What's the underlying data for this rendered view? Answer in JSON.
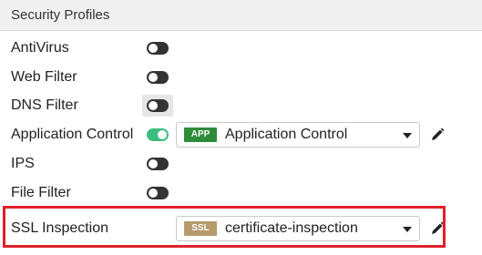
{
  "section": {
    "title": "Security Profiles"
  },
  "profiles": [
    {
      "label": "AntiVirus",
      "enabled": false
    },
    {
      "label": "Web Filter",
      "enabled": false
    },
    {
      "label": "DNS Filter",
      "enabled": false,
      "focused": true
    },
    {
      "label": "Application Control",
      "enabled": true,
      "select": {
        "badge": "APP",
        "badge_color": "#2e8b3a",
        "value": "Application Control"
      }
    },
    {
      "label": "IPS",
      "enabled": false
    },
    {
      "label": "File Filter",
      "enabled": false
    },
    {
      "label": "SSL Inspection",
      "select": {
        "badge": "SSL",
        "badge_color": "#b59a6b",
        "value": "certificate-inspection"
      }
    }
  ],
  "colors": {
    "toggle_on": "#3dbd7d",
    "toggle_off": "#333333",
    "highlight_border": "#e0202a"
  },
  "icons": {
    "edit": "pencil-icon",
    "dropdown": "caret-down-icon"
  }
}
